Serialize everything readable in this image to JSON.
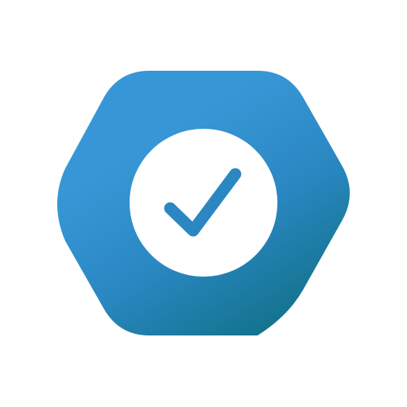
{
  "icon": {
    "name": "verified-check-badge",
    "shape": "rounded-hexagon",
    "gradient_start": "#3797d6",
    "gradient_mid": "#2a87c2",
    "gradient_end": "#0f6f82",
    "inner_circle_color": "#ffffff",
    "check_color": "#2a87c2",
    "background": "#ffffff"
  }
}
